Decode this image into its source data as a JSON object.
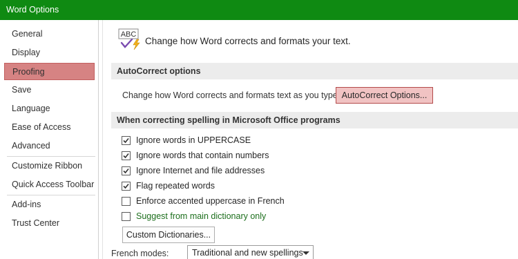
{
  "window": {
    "title": "Word Options"
  },
  "sidebar": {
    "items": [
      {
        "label": "General"
      },
      {
        "label": "Display"
      },
      {
        "label": "Proofing",
        "selected": true
      },
      {
        "label": "Save"
      },
      {
        "label": "Language"
      },
      {
        "label": "Ease of Access"
      },
      {
        "label": "Advanced"
      },
      {
        "label": "Customize Ribbon"
      },
      {
        "label": "Quick Access Toolbar"
      },
      {
        "label": "Add-ins"
      },
      {
        "label": "Trust Center"
      }
    ]
  },
  "header": {
    "icon": "abc-check-icon",
    "icon_text": "ABC",
    "text": "Change how Word corrects and formats your text."
  },
  "autocorrect": {
    "heading": "AutoCorrect options",
    "description": "Change how Word corrects and formats text as you type:",
    "button_label": "AutoCorrect Options..."
  },
  "spelling": {
    "heading": "When correcting spelling in Microsoft Office programs",
    "options": [
      {
        "label": "Ignore words in UPPERCASE",
        "checked": true
      },
      {
        "label": "Ignore words that contain numbers",
        "checked": true
      },
      {
        "label": "Ignore Internet and file addresses",
        "checked": true
      },
      {
        "label": "Flag repeated words",
        "checked": true
      },
      {
        "label": "Enforce accented uppercase in French",
        "checked": false
      },
      {
        "label": "Suggest from main dictionary only",
        "checked": false
      }
    ],
    "custom_dictionaries_label": "Custom Dictionaries..."
  },
  "french": {
    "label": "French modes:",
    "selected": "Traditional and new spellings"
  },
  "colors": {
    "titlebar": "#0f8a12",
    "selected_nav": "#d68383",
    "highlight_button": "#f1c3c3"
  }
}
